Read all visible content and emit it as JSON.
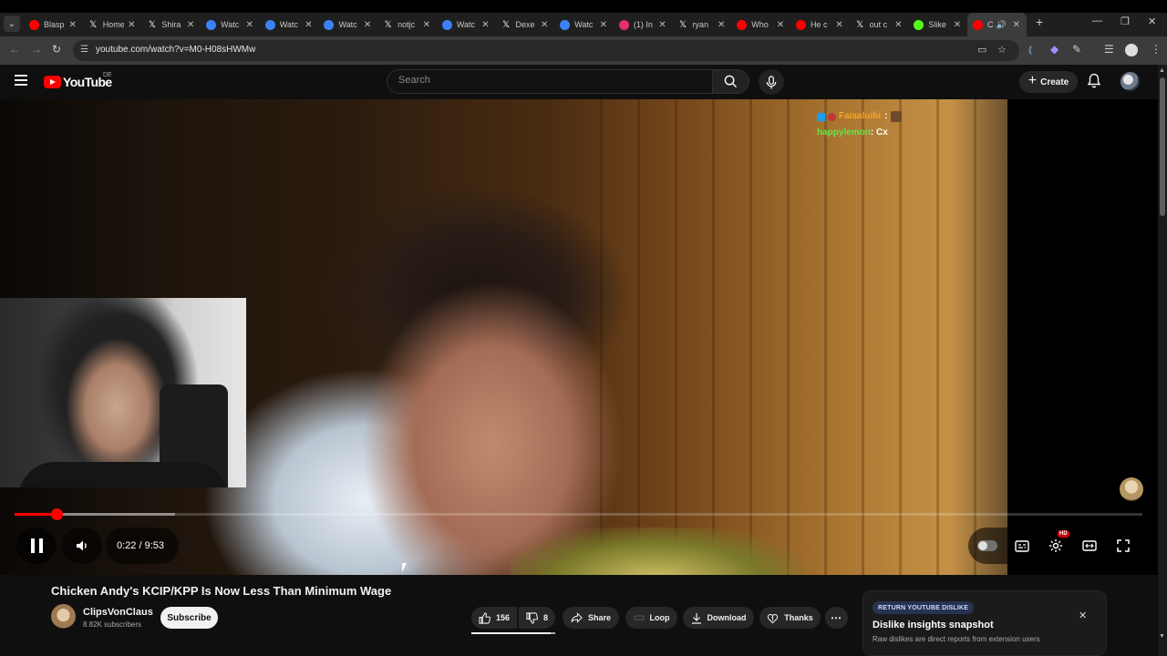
{
  "browser": {
    "tabs": [
      {
        "title": "Blasp",
        "icon": "youtube-icon",
        "color": "#ff0000"
      },
      {
        "title": "Home",
        "icon": "x-icon",
        "color": "#000000"
      },
      {
        "title": "Shira",
        "icon": "x-icon",
        "color": "#000000"
      },
      {
        "title": "Watc",
        "icon": "watch-icon",
        "color": "#3b82f6"
      },
      {
        "title": "Watc",
        "icon": "watch-icon",
        "color": "#3b82f6"
      },
      {
        "title": "Watc",
        "icon": "watch-icon",
        "color": "#3b82f6"
      },
      {
        "title": "notjc",
        "icon": "x-icon",
        "color": "#000000"
      },
      {
        "title": "Watc",
        "icon": "watch-icon",
        "color": "#3b82f6"
      },
      {
        "title": "Dexe",
        "icon": "x-icon",
        "color": "#000000"
      },
      {
        "title": "Watc",
        "icon": "watch-icon",
        "color": "#3b82f6"
      },
      {
        "title": "(1) In",
        "icon": "instagram-icon",
        "color": "#e1306c"
      },
      {
        "title": "ryan",
        "icon": "x-icon",
        "color": "#000000"
      },
      {
        "title": "Who",
        "icon": "youtube-icon",
        "color": "#ff0000"
      },
      {
        "title": "He c",
        "icon": "youtube-icon",
        "color": "#ff0000"
      },
      {
        "title": "out c",
        "icon": "x-icon",
        "color": "#000000"
      },
      {
        "title": "Slike",
        "icon": "kick-icon",
        "color": "#53fc18"
      },
      {
        "title": "C",
        "icon": "youtube-icon",
        "color": "#ff0000",
        "active": true
      }
    ],
    "url": "youtube.com/watch?v=M0-H08sHWMw"
  },
  "masthead": {
    "logo_text": "YouTube",
    "country": "DE",
    "search_placeholder": "Search",
    "create_label": "Create"
  },
  "player": {
    "chat": [
      {
        "user": "Faisaluibi",
        "message": ":"
      },
      {
        "user": "happylemon",
        "message": ": Cx"
      }
    ],
    "time": "0:22 / 9:53",
    "progress_fraction": 0.0371,
    "buffer_fraction": 0.142,
    "hd_badge": "HD"
  },
  "video": {
    "title": "Chicken Andy's KCIP/KPP Is Now Less Than Minimum Wage",
    "channel": "ClipsVonClaus",
    "subscribers": "8.82K subscribers",
    "subscribe_label": "Subscribe",
    "likes": "156",
    "dislikes": "8",
    "like_ratio": 0.951,
    "share_label": "Share",
    "loop_label": "Loop",
    "download_label": "Download",
    "thanks_label": "Thanks"
  },
  "rtd_panel": {
    "tag": "RETURN YOUTUBE DISLIKE",
    "heading": "Dislike insights snapshot",
    "subtext": "Raw dislikes are direct reports from extension users"
  },
  "colors": {
    "accent": "#ff0000",
    "background": "#0f0f0f",
    "chat_user_1": "#f5a623",
    "chat_user_2": "#6be34b"
  }
}
